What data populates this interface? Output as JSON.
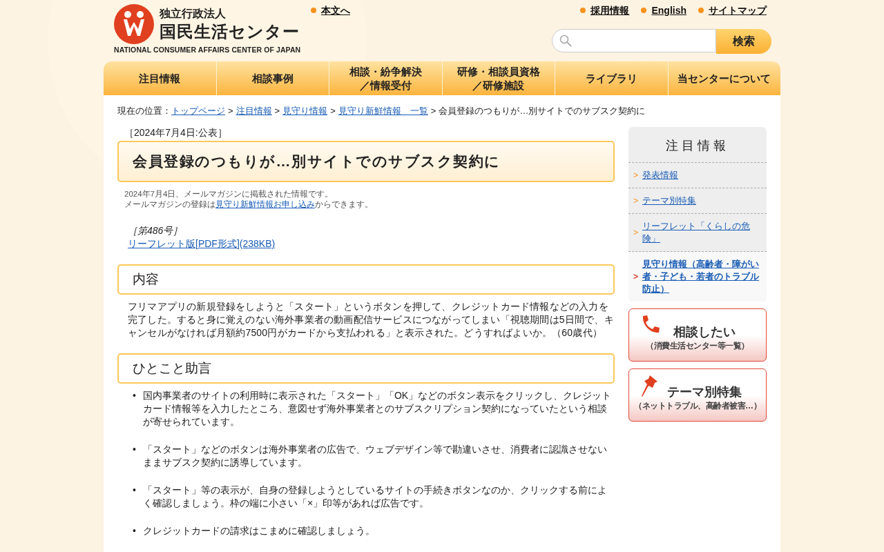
{
  "header": {
    "logo": {
      "org_type": "独立行政法人",
      "name": "国民生活センター",
      "english": "NATIONAL CONSUMER AFFAIRS CENTER OF JAPAN"
    },
    "skip_link": "本文へ",
    "top_links": [
      "採用情報",
      "English",
      "サイトマップ"
    ],
    "search": {
      "button": "検索"
    }
  },
  "nav": [
    {
      "lines": [
        "注目情報"
      ]
    },
    {
      "lines": [
        "相談事例"
      ]
    },
    {
      "lines": [
        "相談・紛争解決",
        "／情報受付"
      ]
    },
    {
      "lines": [
        "研修・相談員資格",
        "／研修施設"
      ]
    },
    {
      "lines": [
        "ライブラリ"
      ]
    },
    {
      "lines": [
        "当センターについて"
      ]
    }
  ],
  "breadcrumb": {
    "prefix": "現在の位置：",
    "separator": ">",
    "links": [
      "トップページ",
      "注目情報",
      "見守り情報",
      "見守り新鮮情報　一覧"
    ],
    "current": "会員登録のつもりが…別サイトでのサブスク契約に"
  },
  "article": {
    "date": "［2024年7月4日:公表］",
    "title": "会員登録のつもりが…別サイトでのサブスク契約に",
    "note_line1": "2024年7月4日、メールマガジンに掲載された情報です。",
    "note_line2": {
      "before": "メールマガジンの登録は",
      "link": "見守り新鮮情報お申し込み",
      "after": "からできます。"
    },
    "issue": "［第486号］",
    "leaflet_link": "リーフレット版[PDF形式](238KB)",
    "sections": [
      {
        "heading": "内容",
        "kind": "paragraph",
        "text": "フリマアプリの新規登録をしようと「スタート」というボタンを押して、クレジットカード情報などの入力を完了した。すると身に覚えのない海外事業者の動画配信サービスにつながってしまい「視聴期間は5日間で、キャンセルがなければ月額約7500円がカードから支払われる」と表示された。どうすればよいか。（60歳代）"
      },
      {
        "heading": "ひとこと助言",
        "kind": "bullets",
        "bullet": "•",
        "items": [
          "国内事業者のサイトの利用時に表示された「スタート」「OK」などのボタン表示をクリックし、クレジットカード情報等を入力したところ、意図せず海外事業者とのサブスクリプション契約になっていたという相談が寄せられています。",
          "「スタート」などのボタンは海外事業者の広告で、ウェブデザイン等で勘違いさせ、消費者に認識させないままサブスク契約に誘導しています。",
          "「スタート」等の表示が、自身の登録しようとしているサイトの手続きボタンなのか、クリックする前によく確認しましょう。枠の端に小さい「×」印等があれば広告です。",
          "クレジットカードの請求はこまめに確認しましょう。"
        ]
      }
    ]
  },
  "sidebar": {
    "title": "注目情報",
    "chevron": ">",
    "items": [
      {
        "label": "発表情報",
        "selected": false
      },
      {
        "label": "テーマ別特集",
        "selected": false
      },
      {
        "label": "リーフレット「くらしの危険」",
        "selected": false
      },
      {
        "label": "見守り情報（高齢者・障がい者・子ども・若者のトラブル防止）",
        "selected": true
      }
    ],
    "banners": [
      {
        "kind": "phone",
        "title": "相談したい",
        "subtitle": "（消費生活センター等一覧）"
      },
      {
        "kind": "pin",
        "title": "テーマ別特集",
        "subtitle": "（ネットトラブル、高齢者被害…）"
      }
    ]
  }
}
